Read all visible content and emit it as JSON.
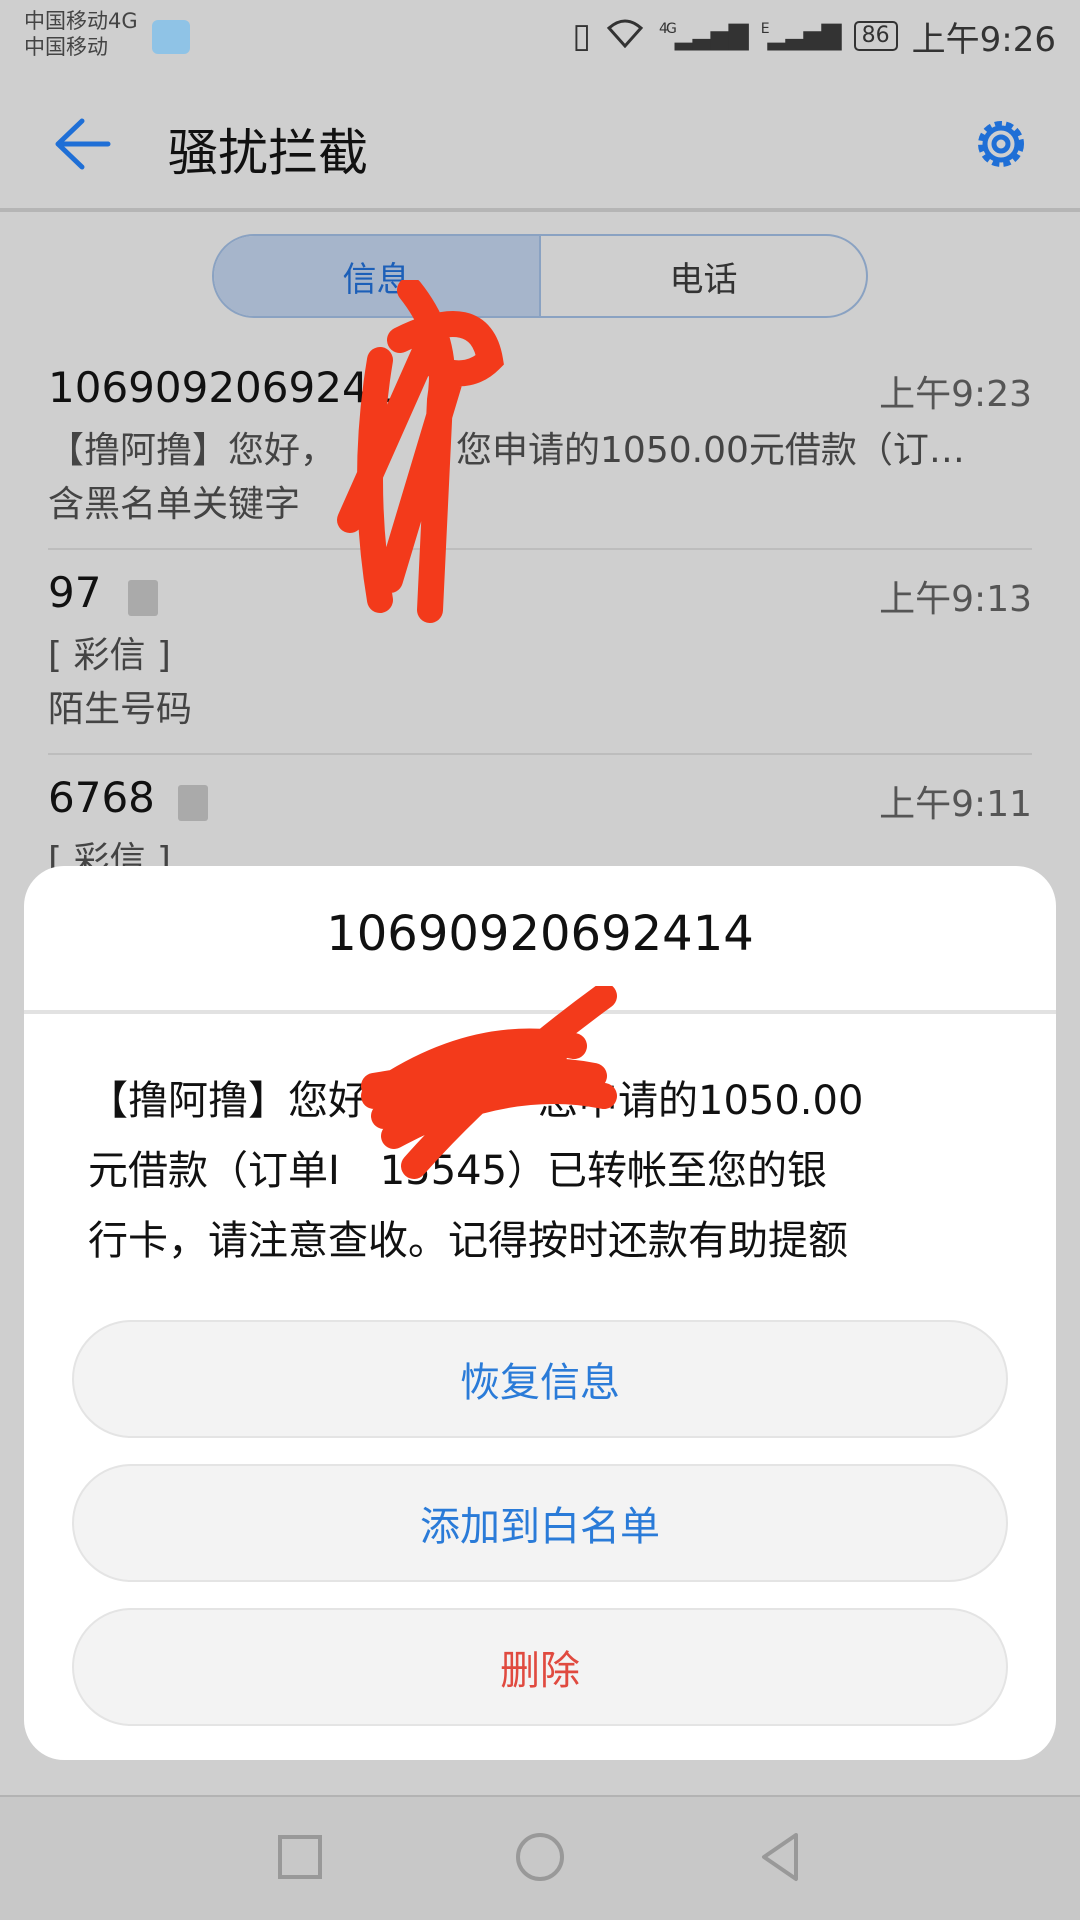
{
  "status_bar": {
    "carrier1": "中国移动4G",
    "carrier2": "中国移动",
    "battery": "86",
    "time": "上午9:26",
    "signal1": "4G",
    "signal2": "E"
  },
  "app_bar": {
    "title": "骚扰拦截"
  },
  "tabs": [
    {
      "label": "信息",
      "active": true
    },
    {
      "label": "电话",
      "active": false
    }
  ],
  "messages": [
    {
      "number": "1069092069241",
      "time": "上午9:23",
      "preview": "【撸阿撸】您好，",
      "preview2": "您申请的1050.00元借款（订…",
      "reason": "含黑名单关键字"
    },
    {
      "number": "97",
      "time": "上午9:13",
      "preview": "[ 彩信 ]",
      "reason": "陌生号码"
    },
    {
      "number": "6768",
      "time": "上午9:11",
      "preview": "[ 彩信 ]"
    }
  ],
  "dialog": {
    "title": "10690920692414",
    "message_p1": "【撸阿撸】您好",
    "message_p2": "您申请的1050.00",
    "message_l2a": "元借款（订单I",
    "message_l2b": "15545）已转帐至您的银",
    "message_l3": "行卡，请注意查收。记得按时还款有助提额",
    "restore_label": "恢复信息",
    "whitelist_label": "添加到白名单",
    "delete_label": "删除"
  },
  "colors": {
    "accent": "#2a7bd8",
    "danger": "#e04a3f",
    "redaction": "#f33a1b"
  }
}
